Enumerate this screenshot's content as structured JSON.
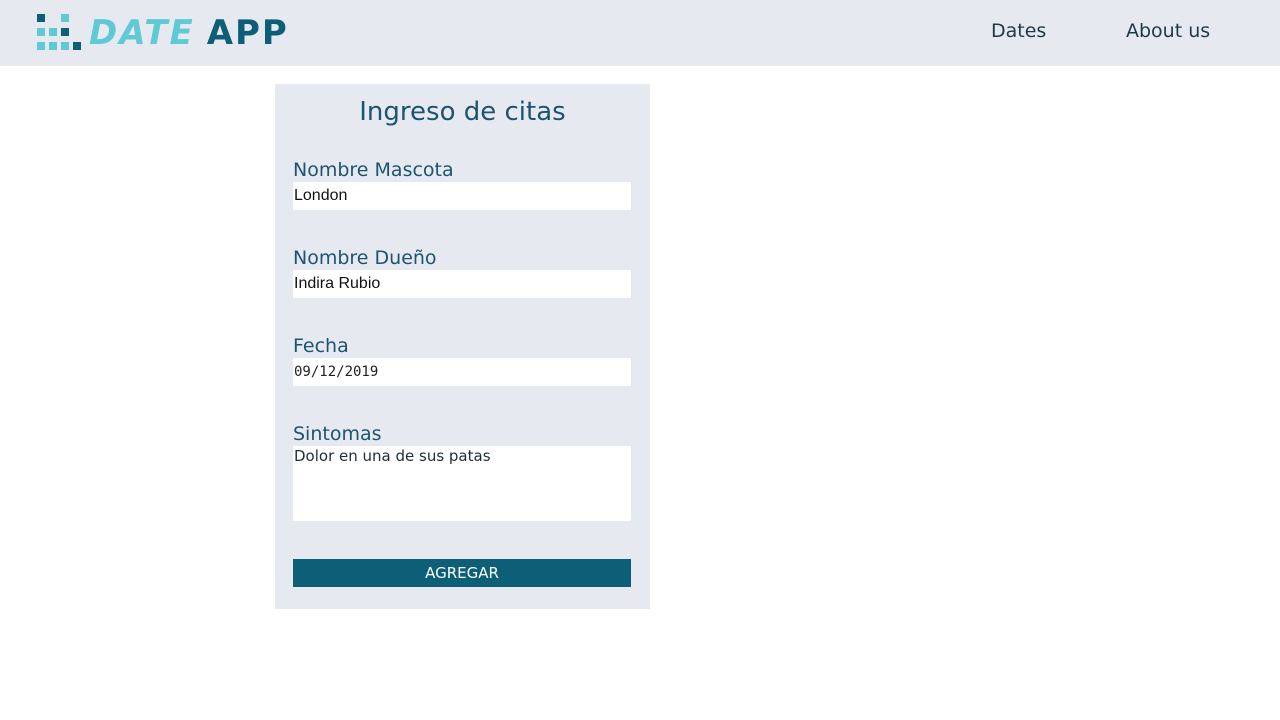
{
  "header": {
    "logo": {
      "word1": "DATE",
      "word2": "APP"
    },
    "nav": [
      {
        "label": "Dates"
      },
      {
        "label": "About us"
      }
    ]
  },
  "form": {
    "title": "Ingreso de citas",
    "fields": {
      "pet_name": {
        "label": "Nombre Mascota",
        "value": "London"
      },
      "owner_name": {
        "label": "Nombre Dueño",
        "value": "Indira Rubio"
      },
      "date": {
        "label": "Fecha",
        "value": "09/12/2019"
      },
      "symptoms": {
        "label": "Sintomas",
        "value": "Dolor en una de sus patas"
      }
    },
    "submit_label": "AGREGAR"
  },
  "colors": {
    "header_bg": "#e6e9f0",
    "card_bg": "#e6e9f0",
    "primary": "#0d5f77",
    "accent": "#5fc9d6",
    "label_text": "#1d5470"
  }
}
